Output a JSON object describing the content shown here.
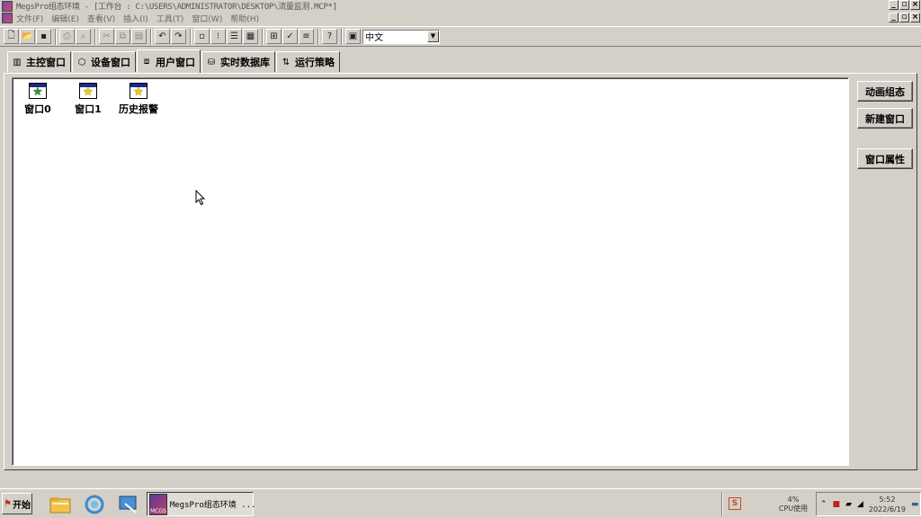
{
  "window": {
    "title": "MegsPro组态环境 - [工作台 : C:\\USERS\\ADMINISTRATOR\\DESKTOP\\流量监测.MCP*]"
  },
  "menu": {
    "items": [
      "文件(F)",
      "编辑(E)",
      "查看(V)",
      "插入(I)",
      "工具(T)",
      "窗口(W)",
      "帮助(H)"
    ]
  },
  "toolbar": {
    "language_value": "中文"
  },
  "tabs": [
    {
      "label": "主控窗口",
      "icon": "main-control-icon"
    },
    {
      "label": "设备窗口",
      "icon": "device-icon"
    },
    {
      "label": "用户窗口",
      "icon": "user-window-icon",
      "active": true
    },
    {
      "label": "实时数据库",
      "icon": "database-icon"
    },
    {
      "label": "运行策略",
      "icon": "strategy-icon"
    }
  ],
  "user_windows": [
    {
      "label": "窗口0",
      "star_color": "#2a9a2a"
    },
    {
      "label": "窗口1",
      "star_color": "#f0d000"
    },
    {
      "label": "历史报警",
      "star_color": "#f0d000"
    }
  ],
  "side_buttons": {
    "animation": "动画组态",
    "new_window": "新建窗口",
    "properties": "窗口属性"
  },
  "taskbar": {
    "start_label": "开始",
    "task_label": "MegsPro组态环境 ...",
    "task_icon_text": "MCGS",
    "ime_label": "S",
    "cpu_percent": "4%",
    "cpu_label": "CPU使用",
    "time": "5:52",
    "date": "2022/6/19"
  }
}
